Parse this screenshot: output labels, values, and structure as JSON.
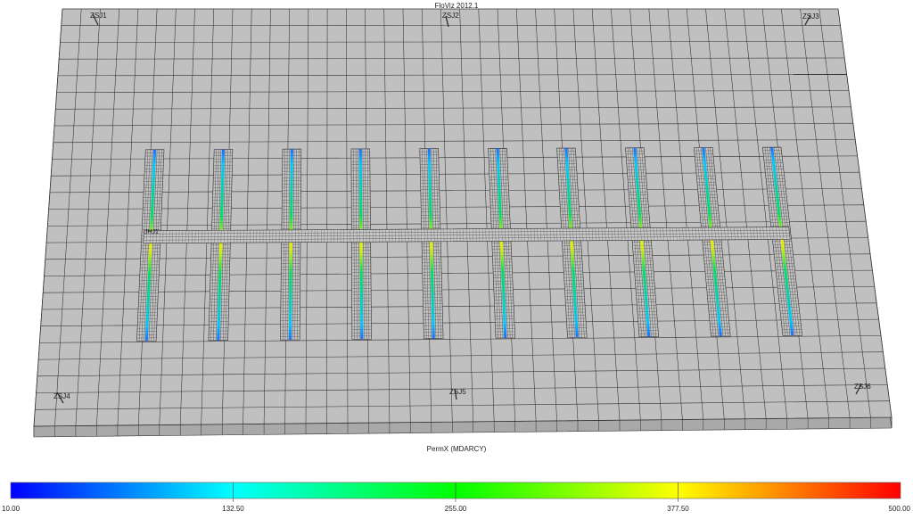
{
  "title": "FloViz 2012.1",
  "property_label": "PermX (MDARCY)",
  "wells": {
    "top_left": "ZSJ1",
    "top_center": "ZSJ2",
    "top_right": "ZSJ3",
    "bottom_left": "ZSJ4",
    "bottom_center": "ZSJ5",
    "bottom_right": "ZSJ6",
    "horizontal": "JHJ1"
  },
  "colorbar": {
    "min": "10.00",
    "t1": "132.50",
    "mid": "255.00",
    "t3": "377.50",
    "max": "500.00",
    "colors": [
      "#0000ff",
      "#00ffff",
      "#00ff00",
      "#ffff00",
      "#ff0000"
    ]
  },
  "grid": {
    "fill": "#c0c0c0",
    "side_fill": "#a9a9a9",
    "line_color": "#303030"
  }
}
